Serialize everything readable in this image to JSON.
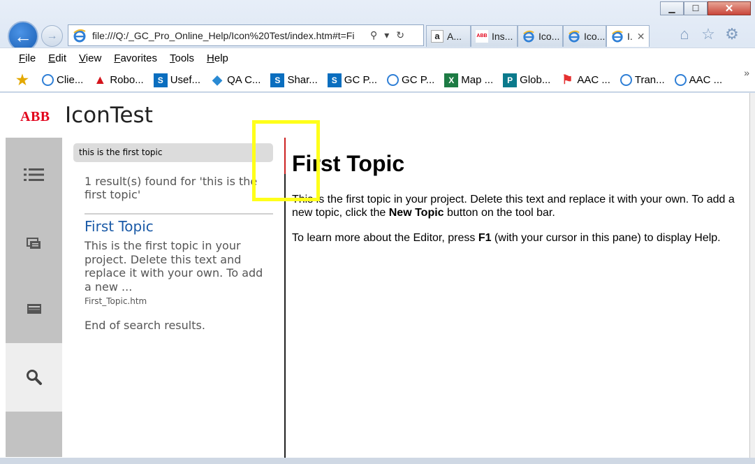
{
  "browser": {
    "address": "file:///Q:/_GC_Pro_Online_Help/Icon%20Test/index.htm#t=Fi",
    "tabs": [
      {
        "label": "A...",
        "icon": "amazon-icon"
      },
      {
        "label": "Ins...",
        "icon": "abb-icon",
        "icon_text": "ABB"
      },
      {
        "label": "Ico...",
        "icon": "ie-icon"
      },
      {
        "label": "Ico...",
        "icon": "ie-icon"
      },
      {
        "label": "I.",
        "icon": "ie-icon",
        "active": true
      }
    ],
    "menu": [
      "File",
      "Edit",
      "View",
      "Favorites",
      "Tools",
      "Help"
    ],
    "favorites": [
      {
        "label": "Clie...",
        "icon": "ie-icon"
      },
      {
        "label": "Robo...",
        "icon": "adobe-icon"
      },
      {
        "label": "Usef...",
        "icon": "sharepoint-icon",
        "icon_text": "S"
      },
      {
        "label": "QA C...",
        "icon": "diamond-icon"
      },
      {
        "label": "Shar...",
        "icon": "sharepoint-icon",
        "icon_text": "S"
      },
      {
        "label": "GC P...",
        "icon": "sharepoint-icon",
        "icon_text": "S"
      },
      {
        "label": "GC P...",
        "icon": "ie-icon"
      },
      {
        "label": "Map ...",
        "icon": "excel-icon",
        "icon_text": "X"
      },
      {
        "label": "Glob...",
        "icon": "publisher-icon",
        "icon_text": "P"
      },
      {
        "label": "AAC ...",
        "icon": "flag-icon"
      },
      {
        "label": "Tran...",
        "icon": "ie-icon"
      },
      {
        "label": "AAC ...",
        "icon": "ie-icon"
      }
    ],
    "colors": {
      "accent": "#1a5fb4",
      "tab_active": "#ffffff"
    }
  },
  "app": {
    "logo": "ABB",
    "title": "IconTest",
    "brand_color": "#e2001a"
  },
  "nav": [
    {
      "name": "toc",
      "icon": "list-icon"
    },
    {
      "name": "index",
      "icon": "index-icon"
    },
    {
      "name": "glossary",
      "icon": "glossary-icon"
    },
    {
      "name": "search",
      "icon": "search-icon",
      "active": true
    }
  ],
  "search": {
    "query": "this is the first topic",
    "count_text": "1 result(s) found for 'this is the first topic'",
    "results": [
      {
        "title": "First Topic",
        "snippet": "This is the first topic in your project. Delete this text and replace it with your own. To add a new ...",
        "file": "First_Topic.htm"
      }
    ],
    "end_text": "End of search results."
  },
  "topic": {
    "title": "First Topic",
    "p1_a": "This is the first topic in your project. Delete this text and replace it with your own. To add a new topic, click the ",
    "p1_b": "New Topic",
    "p1_c": " button on the tool bar.",
    "p2_a": "To learn more about the Editor, press ",
    "p2_b": "F1",
    "p2_c": " (with your cursor in this pane) to display Help."
  }
}
